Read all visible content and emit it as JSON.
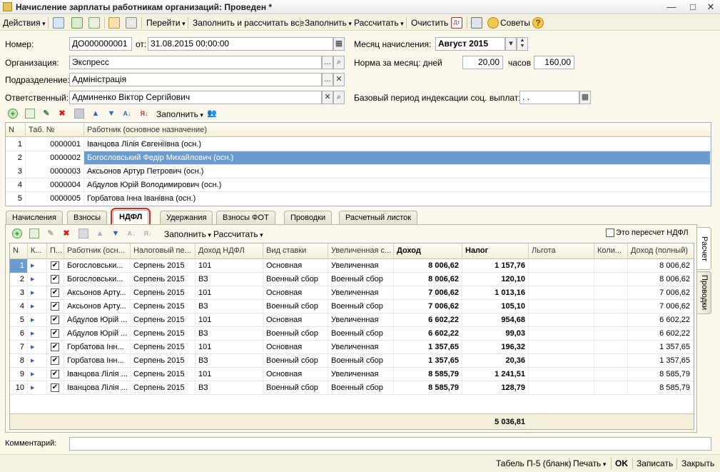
{
  "window": {
    "title": "Начисление зарплаты работникам организаций: Проведен *",
    "minimize": "—",
    "maximize": "□",
    "close": "✕"
  },
  "menubar": {
    "actions": "Действия",
    "goto": "Перейти",
    "fill_and_calc": "Заполнить и рассчитать все",
    "fill": "Заполнить",
    "calculate": "Рассчитать",
    "clear": "Очистить",
    "tips": "Советы",
    "help_glyph": "?"
  },
  "header": {
    "number_label": "Номер:",
    "number_value": "ДО000000001",
    "from_label": "от:",
    "date_value": "31.08.2015 00:00:00",
    "org_label": "Организация:",
    "org_value": "Экспресс",
    "dept_label": "Подразделение:",
    "dept_value": "Адміністрація",
    "resp_label": "Ответственный:",
    "resp_value": "Админенко Віктор Сергійович",
    "month_label": "Месяц начисления:",
    "month_value": "Август 2015",
    "norm_label": "Норма за месяц: дней",
    "norm_days": "20,00",
    "hours_label": "часов",
    "norm_hours": "160,00",
    "base_label": "Базовый период индексации соц. выплат:",
    "base_value": ". ."
  },
  "upper_toolbar": {
    "fill": "Заполнить"
  },
  "employees": {
    "columns": [
      "N",
      "Таб. №",
      "Работник (основное назначение)"
    ],
    "rows": [
      {
        "n": "1",
        "tab": "0000001",
        "name": "Іванцова Лілія Євгеніївна (осн.)"
      },
      {
        "n": "2",
        "tab": "0000002",
        "name": "Богословський Федір Михайлович (осн.)"
      },
      {
        "n": "3",
        "tab": "0000003",
        "name": "Аксьонов Артур Петрович (осн.)"
      },
      {
        "n": "4",
        "tab": "0000004",
        "name": "Абдулов Юрій Володимирович (осн.)"
      },
      {
        "n": "5",
        "tab": "0000005",
        "name": "Горбатова Інна Іванівна (осн.)"
      }
    ],
    "selected_index": 1
  },
  "tabs": [
    "Начисления",
    "Взносы",
    "НДФЛ",
    "Удержания",
    "Взносы ФОТ",
    "Проводки",
    "Расчетный листок"
  ],
  "active_tab": "НДФЛ",
  "side_tabs": [
    "Расчет",
    "Проводки"
  ],
  "ndfl_toolbar": {
    "fill": "Заполнить",
    "calculate": "Рассчитать",
    "recalc_label": "Это пересчет НДФЛ"
  },
  "ndfl": {
    "columns": [
      "N",
      "К...",
      "П...",
      "Работник (осн...",
      "Налоговый пе...",
      "Доход НДФЛ",
      "Вид ставки",
      "Увеличенная с...",
      "Доход",
      "Налог",
      "Льгота",
      "Коли...",
      "Доход (полный)"
    ],
    "rows": [
      {
        "n": "1",
        "emp": "Богословськи...",
        "period": "Серпень 2015",
        "code": "101",
        "rate": "Основная",
        "inc": "Увеличенная",
        "income": "8 006,62",
        "tax": "1 157,76",
        "full": "8 006,62"
      },
      {
        "n": "2",
        "emp": "Богословськи...",
        "period": "Серпень 2015",
        "code": "ВЗ",
        "rate": "Военный сбор",
        "inc": "Военный сбор",
        "income": "8 006,62",
        "tax": "120,10",
        "full": "8 006,62"
      },
      {
        "n": "3",
        "emp": "Аксьонов Арту...",
        "period": "Серпень 2015",
        "code": "101",
        "rate": "Основная",
        "inc": "Увеличенная",
        "income": "7 006,62",
        "tax": "1 013,16",
        "full": "7 006,62"
      },
      {
        "n": "4",
        "emp": "Аксьонов Арту...",
        "period": "Серпень 2015",
        "code": "ВЗ",
        "rate": "Военный сбор",
        "inc": "Военный сбор",
        "income": "7 006,62",
        "tax": "105,10",
        "full": "7 006,62"
      },
      {
        "n": "5",
        "emp": "Абдулов Юрій ...",
        "period": "Серпень 2015",
        "code": "101",
        "rate": "Основная",
        "inc": "Увеличенная",
        "income": "6 602,22",
        "tax": "954,68",
        "full": "6 602,22"
      },
      {
        "n": "6",
        "emp": "Абдулов Юрій ...",
        "period": "Серпень 2015",
        "code": "ВЗ",
        "rate": "Военный сбор",
        "inc": "Военный сбор",
        "income": "6 602,22",
        "tax": "99,03",
        "full": "6 602,22"
      },
      {
        "n": "7",
        "emp": "Горбатова Інн...",
        "period": "Серпень 2015",
        "code": "101",
        "rate": "Основная",
        "inc": "Увеличенная",
        "income": "1 357,65",
        "tax": "196,32",
        "full": "1 357,65"
      },
      {
        "n": "8",
        "emp": "Горбатова Інн...",
        "period": "Серпень 2015",
        "code": "ВЗ",
        "rate": "Военный сбор",
        "inc": "Военный сбор",
        "income": "1 357,65",
        "tax": "20,36",
        "full": "1 357,65"
      },
      {
        "n": "9",
        "emp": "Іванцова Лілія ...",
        "period": "Серпень 2015",
        "code": "101",
        "rate": "Основная",
        "inc": "Увеличенная",
        "income": "8 585,79",
        "tax": "1 241,51",
        "full": "8 585,79"
      },
      {
        "n": "10",
        "emp": "Іванцова Лілія ...",
        "period": "Серпень 2015",
        "code": "ВЗ",
        "rate": "Военный сбор",
        "inc": "Военный сбор",
        "income": "8 585,79",
        "tax": "128,79",
        "full": "8 585,79"
      }
    ],
    "total_tax": "5 036,81"
  },
  "comment_label": "Комментарий:",
  "footer": {
    "tabel": "Табель П-5 (бланк)",
    "print": "Печать",
    "ok": "OK",
    "save": "Записать",
    "close": "Закрыть"
  }
}
